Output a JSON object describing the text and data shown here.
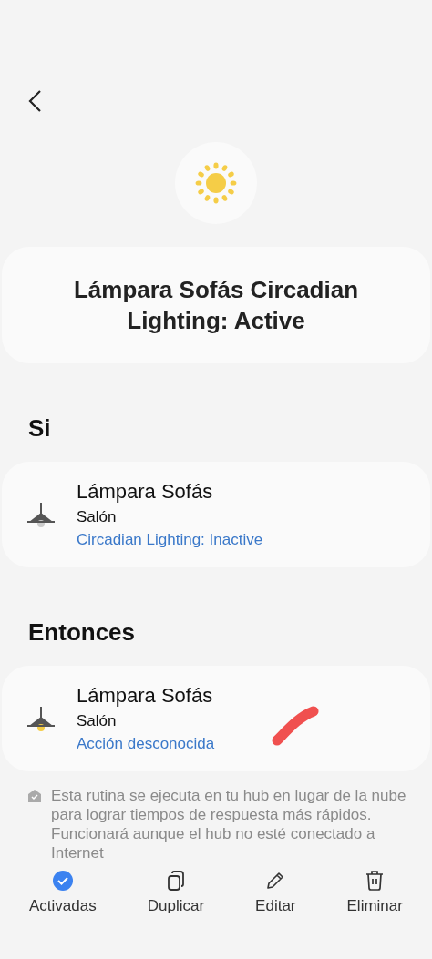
{
  "title": "Lámpara Sofás Circadian Lighting: Active",
  "sections": [
    {
      "heading": "Si",
      "items": [
        {
          "name": "Lámpara Sofás",
          "room": "Salón",
          "status": "Circadian Lighting: Inactive",
          "on": false
        }
      ]
    },
    {
      "heading": "Entonces",
      "items": [
        {
          "name": "Lámpara Sofás",
          "room": "Salón",
          "status": "Acción desconocida",
          "on": true
        }
      ]
    }
  ],
  "info": "Esta rutina se ejecuta en tu hub en lugar de la nube para lograr tiempos de respuesta más rápidos. Funcionará aunque el hub no esté conectado a Internet",
  "actions": [
    {
      "kind": "toggle",
      "label": "Activadas",
      "checked": true
    },
    {
      "kind": "duplicate",
      "label": "Duplicar"
    },
    {
      "kind": "edit",
      "label": "Editar"
    },
    {
      "kind": "delete",
      "label": "Eliminar"
    }
  ]
}
